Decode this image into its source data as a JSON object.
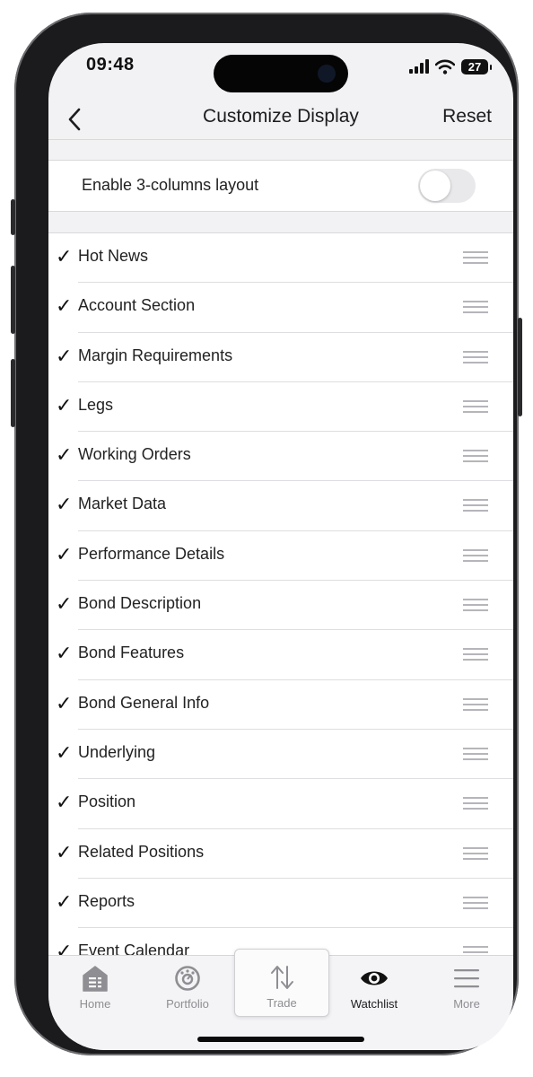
{
  "status_bar": {
    "time": "09:48",
    "battery": "27"
  },
  "nav": {
    "title": "Customize Display",
    "reset_label": "Reset"
  },
  "layout_toggle": {
    "label": "Enable 3-columns layout",
    "enabled": false
  },
  "sections": [
    {
      "label": "Hot News",
      "checked": true
    },
    {
      "label": "Account Section",
      "checked": true
    },
    {
      "label": "Margin Requirements",
      "checked": true
    },
    {
      "label": "Legs",
      "checked": true
    },
    {
      "label": "Working Orders",
      "checked": true
    },
    {
      "label": "Market Data",
      "checked": true
    },
    {
      "label": "Performance Details",
      "checked": true
    },
    {
      "label": "Bond Description",
      "checked": true
    },
    {
      "label": "Bond Features",
      "checked": true
    },
    {
      "label": "Bond General Info",
      "checked": true
    },
    {
      "label": "Underlying",
      "checked": true
    },
    {
      "label": "Position",
      "checked": true
    },
    {
      "label": "Related Positions",
      "checked": true
    },
    {
      "label": "Reports",
      "checked": true
    },
    {
      "label": "Event Calendar",
      "checked": true
    }
  ],
  "check_glyph": "✓",
  "tabs": [
    {
      "label": "Home",
      "icon": "home-icon"
    },
    {
      "label": "Portfolio",
      "icon": "portfolio-icon"
    },
    {
      "label": "Trade",
      "icon": "trade-arrows-icon"
    },
    {
      "label": "Watchlist",
      "icon": "eye-icon"
    },
    {
      "label": "More",
      "icon": "menu-icon"
    }
  ],
  "colors": {
    "active_tab": "#1c1c1e",
    "inactive_tab": "#8e8e93",
    "toggle_off": "#e9e9eb"
  }
}
